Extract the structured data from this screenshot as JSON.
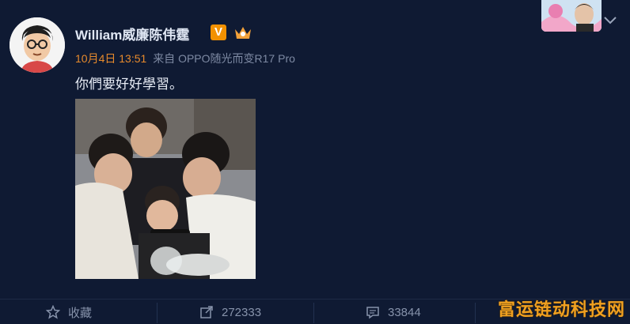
{
  "post": {
    "username": "William威廉陈伟霆",
    "verified_badge": "V",
    "date": "10月4日 13:51",
    "source": "来自 OPPO随光而变R17 Pro",
    "text": "你們要好好學習。"
  },
  "actions": {
    "favorite_label": "收藏",
    "repost_count": "272333",
    "comment_count": "33844"
  },
  "watermark": "富运链动科技网",
  "colors": {
    "background": "#0f1a33",
    "date": "#e78a2c",
    "badge": "#f29100",
    "muted": "#8793ab"
  },
  "icons": [
    "star-icon",
    "share-icon",
    "comment-icon",
    "chevron-down-icon",
    "crown-icon"
  ]
}
